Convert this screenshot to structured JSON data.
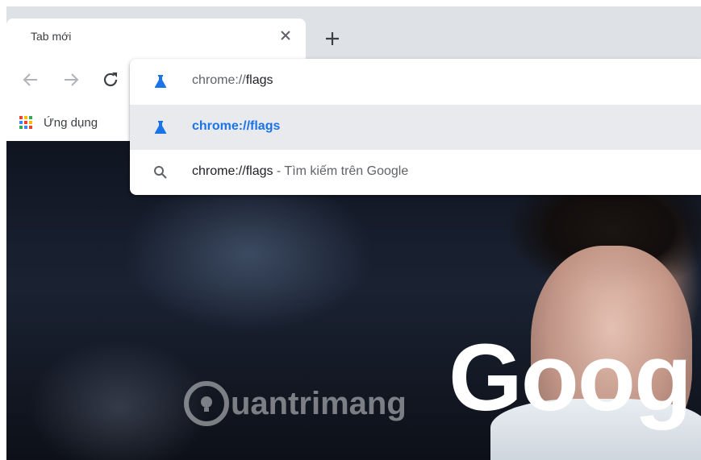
{
  "tab": {
    "title": "Tab mới",
    "close_icon": "close-icon"
  },
  "toolbar": {
    "new_tab_icon": "plus-icon",
    "back_icon": "arrow-left-icon",
    "forward_icon": "arrow-right-icon",
    "reload_icon": "reload-icon"
  },
  "bookmarks": {
    "apps_label": "Ứng dụng"
  },
  "omnibox": {
    "input_prefix": "chrome://",
    "input_typed": "flags",
    "suggestions": [
      {
        "icon": "flask-icon",
        "text": "chrome://flags",
        "selected": true
      },
      {
        "icon": "search-icon",
        "main": "chrome://flags",
        "suffix": " - Tìm kiếm trên Google",
        "selected": false
      }
    ]
  },
  "background": {
    "logo_text": "Goog",
    "watermark_text": "uantrimang"
  },
  "colors": {
    "accent": "#1a73e8",
    "tabstrip": "#dee1e6",
    "selected_row": "#e8eaed"
  }
}
